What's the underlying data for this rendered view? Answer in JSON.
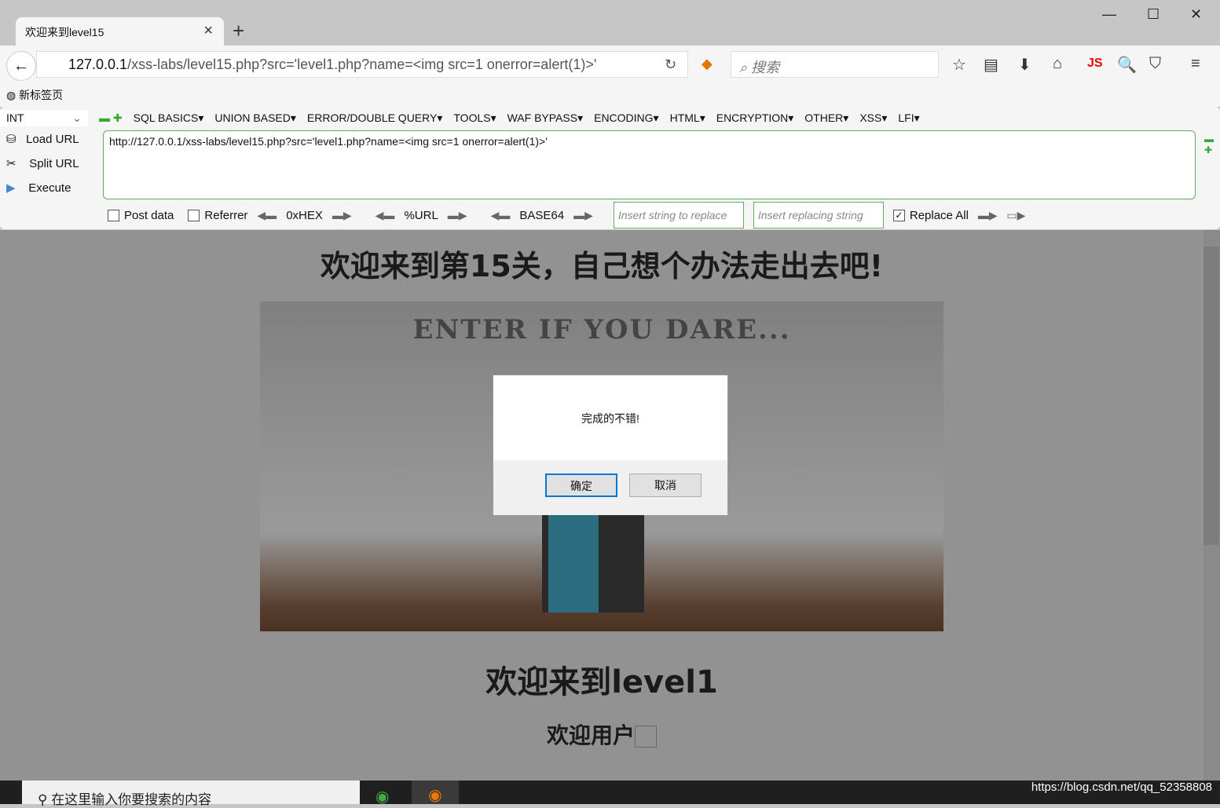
{
  "browser": {
    "tab_title": "欢迎来到level15",
    "url_host": "127.0.0.1",
    "url_path": "/xss-labs/level15.php?src='level1.php?name=<img src=1 onerror=alert(1)>'",
    "search_placeholder": "搜索",
    "bookmark": "新标签页"
  },
  "hackbar": {
    "type_select": "INT",
    "menus": [
      "SQL BASICS",
      "UNION BASED",
      "ERROR/DOUBLE QUERY",
      "TOOLS",
      "WAF BYPASS",
      "ENCODING",
      "HTML",
      "ENCRYPTION",
      "OTHER",
      "XSS",
      "LFI"
    ],
    "load_url": "Load URL",
    "split_url": "Split URL",
    "execute": "Execute",
    "url_value": "http://127.0.0.1/xss-labs/level15.php?src='level1.php?name=<img src=1 onerror=alert(1)>'",
    "post_data": "Post data",
    "referrer": "Referrer",
    "hex": "0xHEX",
    "urlenc": "%URL",
    "base64": "BASE64",
    "replace_placeholder": "Insert string to replace",
    "replacing_placeholder": "Insert replacing string",
    "replace_all": "Replace All"
  },
  "page": {
    "heading": "欢迎来到第15关，自己想个办法走出去吧!",
    "image_text": "ENTER IF YOU DARE...",
    "sub_heading": "欢迎来到level1",
    "user_text": "欢迎用户"
  },
  "dialog": {
    "message": "完成的不错!",
    "ok": "确定",
    "cancel": "取消"
  },
  "taskbar": {
    "search_placeholder": "在这里输入你要搜索的内容",
    "watermark": "https://blog.csdn.net/qq_52358808"
  }
}
